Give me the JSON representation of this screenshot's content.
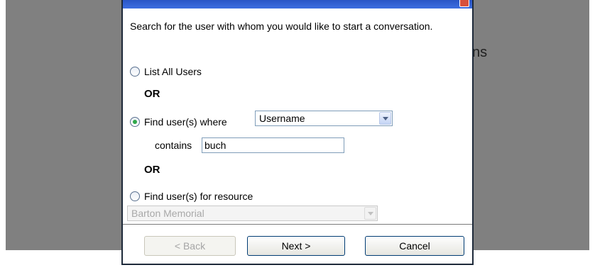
{
  "background": {
    "heading_fragment": "ns"
  },
  "dialog": {
    "instructions": "Search for the user with whom you would like to start a conversation.",
    "options": {
      "list_all_label": "List All Users",
      "or_1": "OR",
      "find_where_label": "Find user(s) where",
      "field_select_value": "Username",
      "contains_label": "contains",
      "contains_value": "buch",
      "or_2": "OR",
      "find_resource_label": "Find user(s) for resource",
      "resource_select_value": "Barton Memorial"
    },
    "selected_option": "find_where",
    "buttons": {
      "back": "< Back",
      "next": "Next >",
      "cancel": "Cancel"
    }
  },
  "colors": {
    "backdrop": "#808080",
    "titlebar": "#2a56c6",
    "radio_dot": "#2fa84a"
  }
}
